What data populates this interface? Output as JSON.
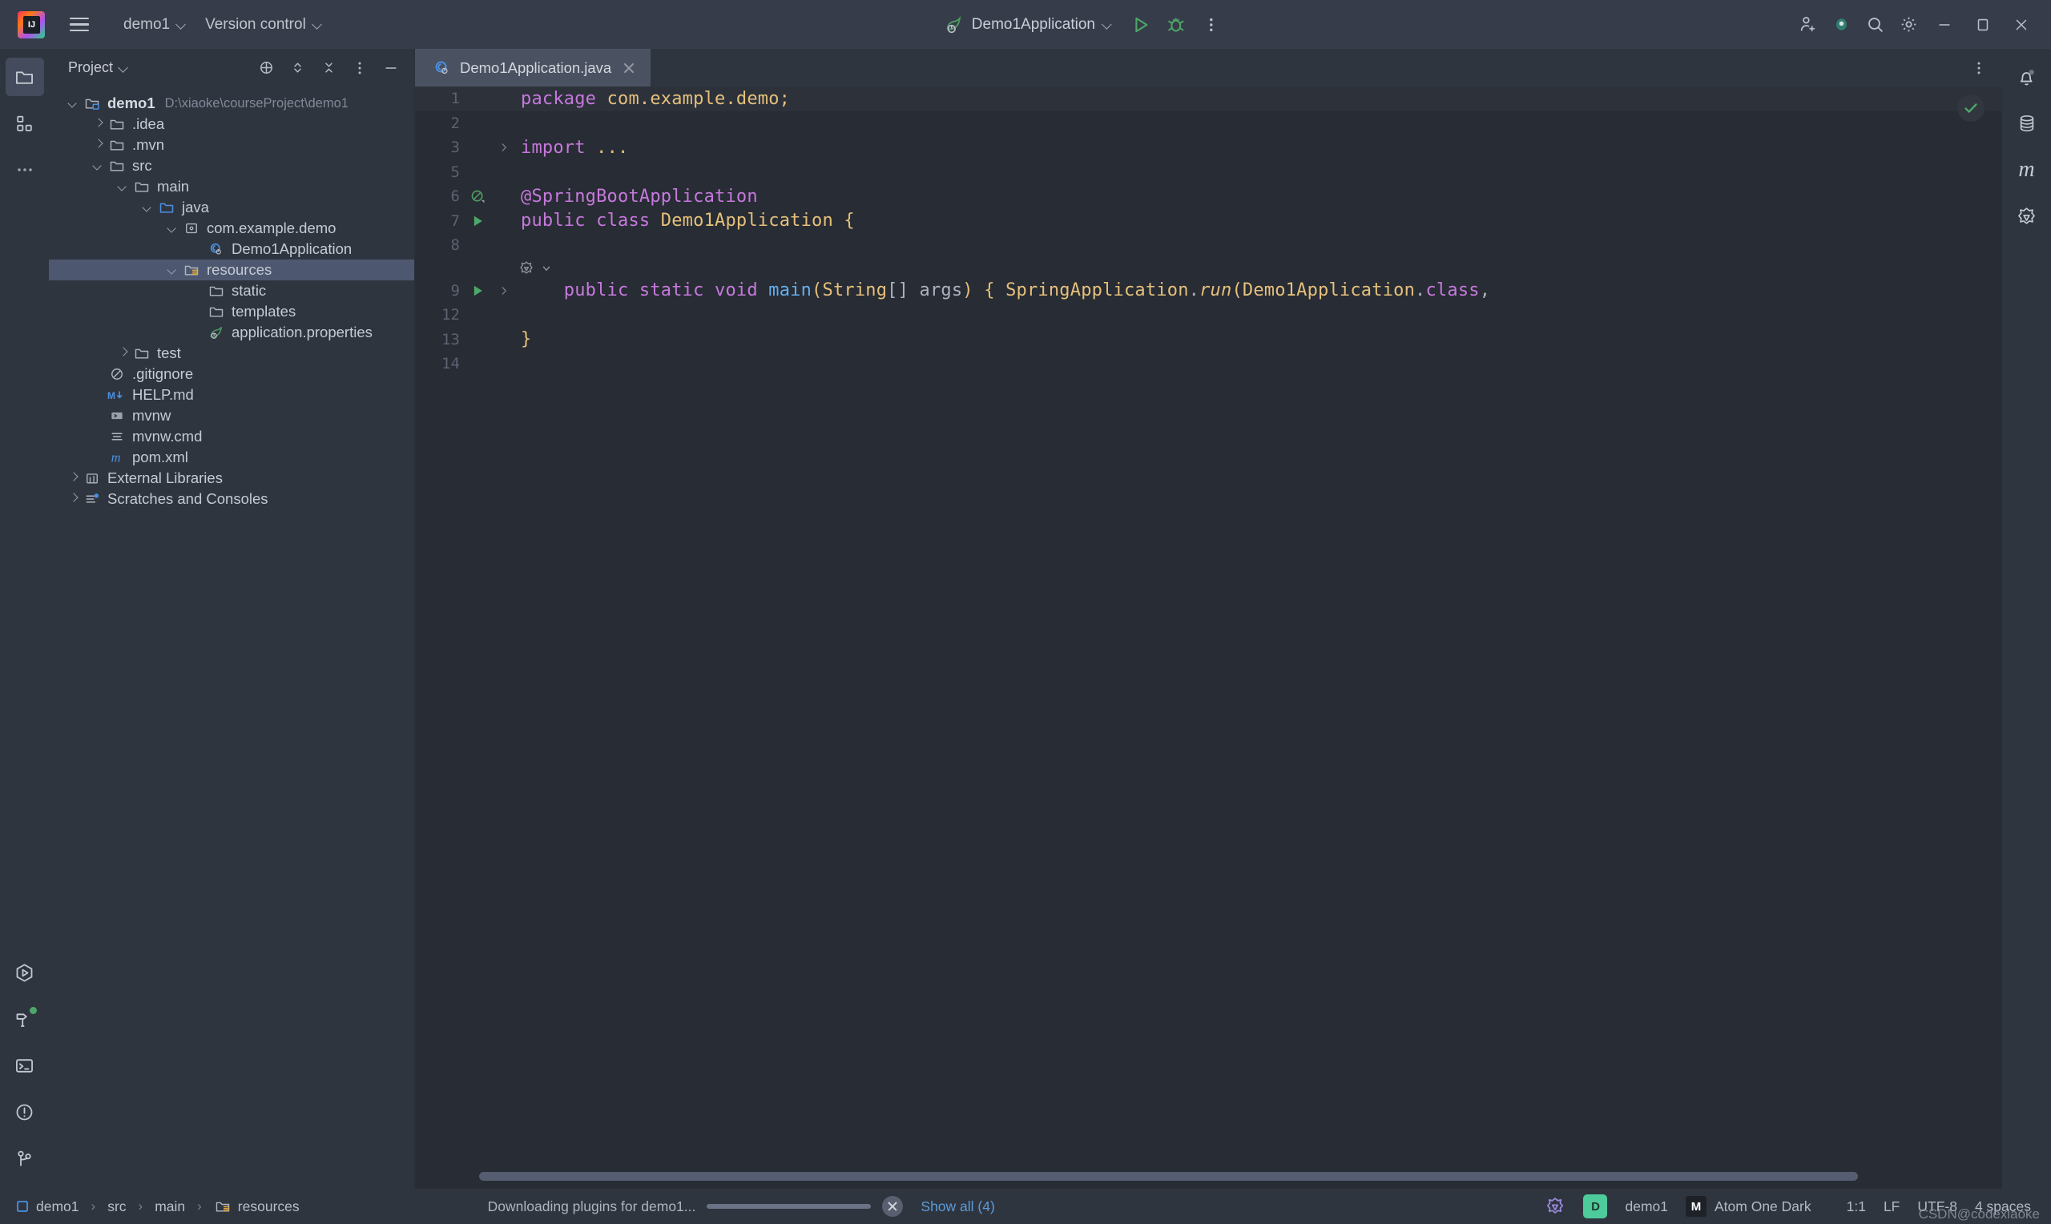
{
  "window": {
    "app_logo": "intellij-idea-logo",
    "menu_items": [
      {
        "label": "demo1",
        "has_chevron": true
      },
      {
        "label": "Version control",
        "has_chevron": true
      }
    ],
    "run_config": {
      "label": "Demo1Application",
      "icon": "spring-leaf-icon",
      "has_chevron": true
    },
    "toolbar_buttons": [
      "run-icon",
      "debug-icon",
      "more-actions-icon"
    ],
    "right_buttons": [
      "add-user-icon",
      "code-with-me-icon",
      "search-icon",
      "settings-icon"
    ],
    "window_controls": [
      "minimize",
      "maximize",
      "close"
    ]
  },
  "rail_left": {
    "top_items": [
      {
        "name": "project-tool-window",
        "icon": "folder-icon",
        "active": true
      },
      {
        "name": "structure-tool-window",
        "icon": "structure-icon",
        "active": false
      },
      {
        "name": "more-tool-windows",
        "icon": "ellipsis-icon",
        "active": false
      }
    ],
    "bottom_items": [
      {
        "name": "run-tool-window",
        "icon": "run-hex-icon",
        "badge": false
      },
      {
        "name": "build-tool-window",
        "icon": "hammer-icon",
        "badge": true
      },
      {
        "name": "terminal-tool-window",
        "icon": "terminal-icon",
        "badge": false
      },
      {
        "name": "problems-tool-window",
        "icon": "warning-circle-icon",
        "badge": false
      },
      {
        "name": "git-tool-window",
        "icon": "git-branch-icon",
        "badge": false
      }
    ]
  },
  "rail_right": {
    "items": [
      {
        "name": "notifications",
        "icon": "bell-icon",
        "badge": true
      },
      {
        "name": "database",
        "icon": "database-icon",
        "badge": false
      },
      {
        "name": "maven",
        "icon": "maven-m-icon",
        "badge": false
      },
      {
        "name": "spring",
        "icon": "spring-boot-icon",
        "badge": false
      }
    ]
  },
  "project_panel": {
    "title": "Project",
    "tools": [
      "select-opened-file-icon",
      "expand-collapse-icon",
      "collapse-all-icon",
      "options-icon",
      "hide-icon"
    ],
    "tree": [
      {
        "label": "demo1",
        "path": "D:\\xiaoke\\courseProject\\demo1",
        "indent": 0,
        "arrow": "open",
        "icon": "module-folder-icon",
        "bold": true,
        "selected": false
      },
      {
        "label": ".idea",
        "indent": 1,
        "arrow": "closed",
        "icon": "folder-icon",
        "bold": false,
        "selected": false
      },
      {
        "label": ".mvn",
        "indent": 1,
        "arrow": "closed",
        "icon": "folder-icon",
        "bold": false,
        "selected": false
      },
      {
        "label": "src",
        "indent": 1,
        "arrow": "open",
        "icon": "folder-icon",
        "bold": false,
        "selected": false
      },
      {
        "label": "main",
        "indent": 2,
        "arrow": "open",
        "icon": "folder-icon",
        "bold": false,
        "selected": false
      },
      {
        "label": "java",
        "indent": 3,
        "arrow": "open",
        "icon": "source-folder-icon",
        "bold": false,
        "selected": false
      },
      {
        "label": "com.example.demo",
        "indent": 4,
        "arrow": "open",
        "icon": "package-icon",
        "bold": false,
        "selected": false
      },
      {
        "label": "Demo1Application",
        "indent": 5,
        "arrow": "none",
        "icon": "java-class-spring-icon",
        "bold": false,
        "selected": false
      },
      {
        "label": "resources",
        "indent": 4,
        "arrow": "open",
        "icon": "resources-folder-icon",
        "bold": false,
        "selected": true
      },
      {
        "label": "static",
        "indent": 5,
        "arrow": "none",
        "icon": "folder-icon",
        "bold": false,
        "selected": false
      },
      {
        "label": "templates",
        "indent": 5,
        "arrow": "none",
        "icon": "folder-icon",
        "bold": false,
        "selected": false
      },
      {
        "label": "application.properties",
        "indent": 5,
        "arrow": "none",
        "icon": "spring-leaf-icon",
        "bold": false,
        "selected": false
      },
      {
        "label": "test",
        "indent": 2,
        "arrow": "closed",
        "icon": "folder-icon",
        "bold": false,
        "selected": false
      },
      {
        "label": ".gitignore",
        "indent": 1,
        "arrow": "none",
        "icon": "gitignore-icon",
        "bold": false,
        "selected": false
      },
      {
        "label": "HELP.md",
        "indent": 1,
        "arrow": "none",
        "icon": "markdown-icon",
        "bold": false,
        "selected": false
      },
      {
        "label": "mvnw",
        "indent": 1,
        "arrow": "none",
        "icon": "shell-script-icon",
        "bold": false,
        "selected": false
      },
      {
        "label": "mvnw.cmd",
        "indent": 1,
        "arrow": "none",
        "icon": "text-file-icon",
        "bold": false,
        "selected": false
      },
      {
        "label": "pom.xml",
        "indent": 1,
        "arrow": "none",
        "icon": "maven-m-icon",
        "bold": false,
        "selected": false
      },
      {
        "label": "External Libraries",
        "indent": 0,
        "arrow": "closed",
        "icon": "libraries-icon",
        "bold": false,
        "selected": false
      },
      {
        "label": "Scratches and Consoles",
        "indent": 0,
        "arrow": "closed",
        "icon": "scratches-icon",
        "bold": false,
        "selected": false
      }
    ]
  },
  "editor": {
    "tabs": [
      {
        "label": "Demo1Application.java",
        "icon": "java-class-spring-icon",
        "active": true,
        "closable": true
      }
    ],
    "tab_tools": [
      "editor-options-icon"
    ],
    "inspection_status": "ok-check-icon",
    "lines": [
      {
        "no": "1",
        "gutter": "none",
        "fold": "",
        "current": true,
        "tokens": [
          {
            "t": "package ",
            "c": "kw"
          },
          {
            "t": "com.example.demo;",
            "c": "cls"
          }
        ]
      },
      {
        "no": "2",
        "gutter": "none",
        "fold": "",
        "current": false,
        "tokens": []
      },
      {
        "no": "3",
        "gutter": "none",
        "fold": "expand",
        "current": false,
        "tokens": [
          {
            "t": "import ",
            "c": "kw"
          },
          {
            "t": "...",
            "c": "brcy"
          }
        ]
      },
      {
        "no": "5",
        "gutter": "none",
        "fold": "",
        "current": false,
        "tokens": []
      },
      {
        "no": "6",
        "gutter": "bean",
        "fold": "",
        "current": false,
        "tokens": [
          {
            "t": "@SpringBootApplication",
            "c": "kw"
          }
        ]
      },
      {
        "no": "7",
        "gutter": "run",
        "fold": "",
        "current": false,
        "tokens": [
          {
            "t": "public ",
            "c": "kw"
          },
          {
            "t": "class ",
            "c": "kw"
          },
          {
            "t": "Demo1Application ",
            "c": "cls"
          },
          {
            "t": "{",
            "c": "brcy"
          }
        ]
      },
      {
        "no": "8",
        "gutter": "none",
        "fold": "",
        "current": false,
        "tokens": []
      },
      {
        "no": "9",
        "gutter": "run",
        "fold": "expand",
        "current": false,
        "tokens": [
          {
            "t": "    public ",
            "c": "kw"
          },
          {
            "t": "static ",
            "c": "kw"
          },
          {
            "t": "void ",
            "c": "kw"
          },
          {
            "t": "main",
            "c": "mth"
          },
          {
            "t": "(",
            "c": "brcy"
          },
          {
            "t": "String",
            "c": "cls"
          },
          {
            "t": "[] ",
            "c": "pln"
          },
          {
            "t": "args",
            "c": "pln"
          },
          {
            "t": ") ",
            "c": "brcy"
          },
          {
            "t": "{ ",
            "c": "yellowbr"
          },
          {
            "t": "SpringApplication",
            "c": "cls"
          },
          {
            "t": ".",
            "c": "pln"
          },
          {
            "t": "run",
            "c": "ital"
          },
          {
            "t": "(",
            "c": "brcy"
          },
          {
            "t": "Demo1Application",
            "c": "cls"
          },
          {
            "t": ".",
            "c": "pln"
          },
          {
            "t": "class",
            "c": "kw"
          },
          {
            "t": ",",
            "c": "pln"
          }
        ]
      },
      {
        "no": "12",
        "gutter": "none",
        "fold": "",
        "current": false,
        "tokens": []
      },
      {
        "no": "13",
        "gutter": "none",
        "fold": "",
        "current": false,
        "tokens": [
          {
            "t": "}",
            "c": "brcy"
          }
        ]
      },
      {
        "no": "14",
        "gutter": "none",
        "fold": "",
        "current": false,
        "tokens": []
      }
    ],
    "inline_hint": {
      "icon": "spring-bean-icon",
      "chevron": true
    }
  },
  "status_bar": {
    "breadcrumbs": [
      {
        "label": "demo1",
        "icon": "module-square-icon"
      },
      {
        "label": "src",
        "icon": "none"
      },
      {
        "label": "main",
        "icon": "none"
      },
      {
        "label": "resources",
        "icon": "resources-folder-icon"
      }
    ],
    "progress_text": "Downloading plugins for demo1...",
    "show_all_label": "Show all (4)",
    "right_items": [
      {
        "name": "spring-widget",
        "label": "",
        "icon": "spring-boot-icon"
      },
      {
        "name": "database-badge",
        "label": "D",
        "icon": "badge-d"
      },
      {
        "name": "project-name",
        "label": "demo1",
        "icon": "none"
      },
      {
        "name": "theme-name",
        "label": "Atom One Dark",
        "icon": "badge-m"
      },
      {
        "name": "readonly-toggle",
        "label": "",
        "icon": "circle-icon"
      },
      {
        "name": "caret-position",
        "label": "1:1",
        "icon": "none"
      },
      {
        "name": "line-separator",
        "label": "LF",
        "icon": "none"
      },
      {
        "name": "file-encoding",
        "label": "UTF-8",
        "icon": "none"
      },
      {
        "name": "indent-setting",
        "label": "4 spaces",
        "icon": "none"
      }
    ],
    "watermark": "CSDN@codexiaoke"
  }
}
